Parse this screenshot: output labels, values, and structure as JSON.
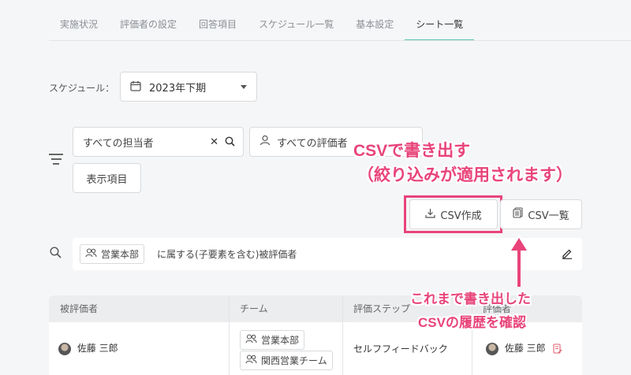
{
  "tabs": [
    {
      "label": "実施状況"
    },
    {
      "label": "評価者の設定"
    },
    {
      "label": "回答項目"
    },
    {
      "label": "スケジュール一覧"
    },
    {
      "label": "基本設定"
    },
    {
      "label": "シート一覧",
      "active": true
    }
  ],
  "schedule": {
    "label": "スケジュール：",
    "value": "2023年下期",
    "icon": "calendar-icon"
  },
  "filters": {
    "assignee_placeholder": "すべての担当者",
    "evaluator_placeholder": "すべての評価者",
    "display_items_label": "表示項目"
  },
  "actions": {
    "csv_create_label": "CSV作成",
    "csv_list_label": "CSV一覧"
  },
  "condition": {
    "chip_label": "営業本部",
    "text": "に属する(子要素を含む)被評価者"
  },
  "table": {
    "headers": [
      "被評価者",
      "チーム",
      "評価ステップ",
      "評価者"
    ],
    "rows": [
      {
        "evaluatee": "佐藤 三郎",
        "teams": [
          "営業本部",
          "関西営業チーム"
        ],
        "step": "セルフフィードバック",
        "evaluator": "佐藤 三郎"
      }
    ]
  },
  "annotations": {
    "csv_export_line1": "CSVで書き出す",
    "csv_export_line2": "（絞り込みが適用されます）",
    "history_line1": "これまで書き出した",
    "history_line2": "CSVの履歴を確認"
  },
  "colors": {
    "accent": "#5bc2b2",
    "annotation": "#e8447a"
  }
}
